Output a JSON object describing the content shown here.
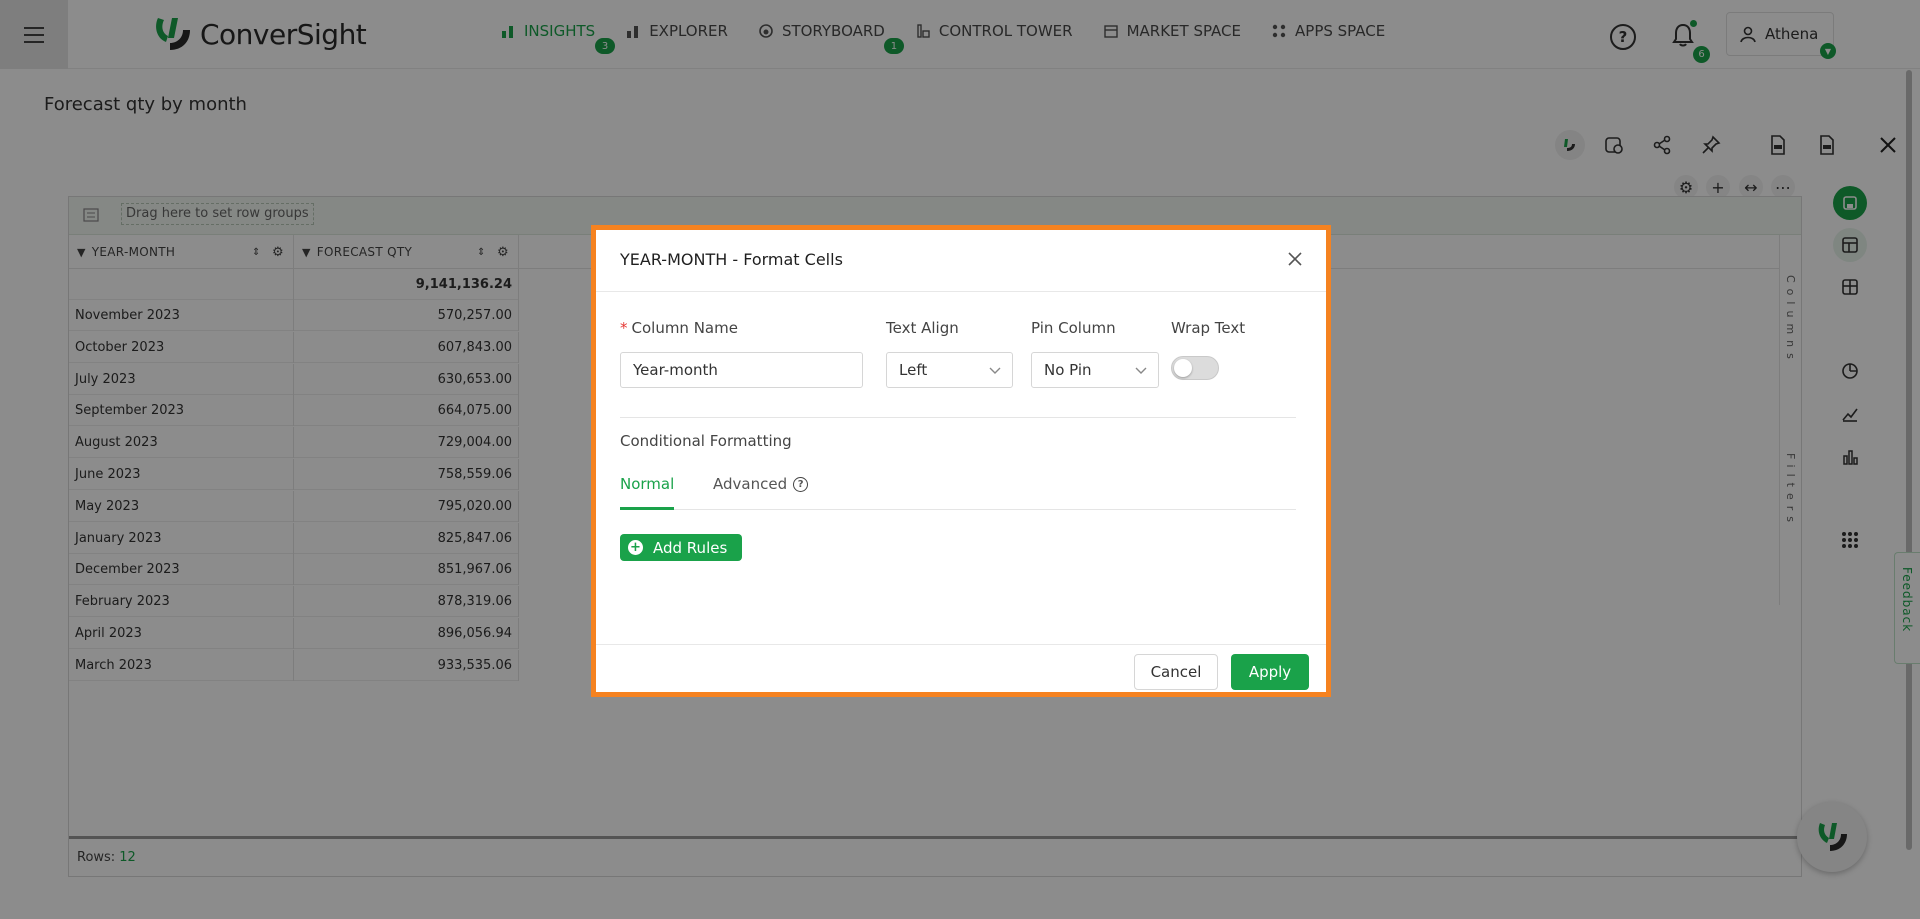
{
  "app": {
    "brand_name": "ConverSight",
    "colors": {
      "accent": "#1aa24a",
      "highlight": "#f58220"
    }
  },
  "nav": {
    "items": [
      {
        "label": "INSIGHTS",
        "icon": "bar-chart-icon",
        "badge": "3",
        "active": true
      },
      {
        "label": "EXPLORER",
        "icon": "explorer-icon",
        "badge": ""
      },
      {
        "label": "STORYBOARD",
        "icon": "storyboard-icon",
        "badge": "1"
      },
      {
        "label": "CONTROL TOWER",
        "icon": "control-tower-icon",
        "badge": ""
      },
      {
        "label": "MARKET SPACE",
        "icon": "market-space-icon",
        "badge": ""
      },
      {
        "label": "APPS SPACE",
        "icon": "apps-space-icon",
        "badge": ""
      }
    ],
    "notifications_count": "6",
    "user_name": "Athena"
  },
  "page": {
    "title": "Forecast qty by month"
  },
  "grid": {
    "drag_hint": "Drag here to set row groups",
    "columns": [
      "YEAR-MONTH",
      "FORECAST QTY"
    ],
    "total": "9,141,136.24",
    "rows": [
      {
        "month": "November 2023",
        "qty": "570,257.00"
      },
      {
        "month": "October 2023",
        "qty": "607,843.00"
      },
      {
        "month": "July 2023",
        "qty": "630,653.00"
      },
      {
        "month": "September 2023",
        "qty": "664,075.00"
      },
      {
        "month": "August 2023",
        "qty": "729,004.00"
      },
      {
        "month": "June 2023",
        "qty": "758,559.06"
      },
      {
        "month": "May 2023",
        "qty": "795,020.00"
      },
      {
        "month": "January 2023",
        "qty": "825,847.06"
      },
      {
        "month": "December 2023",
        "qty": "851,967.06"
      },
      {
        "month": "February 2023",
        "qty": "878,319.06"
      },
      {
        "month": "April 2023",
        "qty": "896,056.94"
      },
      {
        "month": "March 2023",
        "qty": "933,535.06"
      }
    ],
    "side_columns_label": "Columns",
    "side_filters_label": "Filters",
    "footer_rows_label": "Rows:",
    "footer_rows_count": "12"
  },
  "feedback_label": "Feedback",
  "modal": {
    "title": "YEAR-MONTH - Format Cells",
    "column_name_label": "Column Name",
    "column_name_value": "Year-month",
    "text_align_label": "Text Align",
    "text_align_value": "Left",
    "pin_column_label": "Pin Column",
    "pin_column_value": "No Pin",
    "wrap_text_label": "Wrap Text",
    "wrap_text_on": false,
    "conditional_formatting_label": "Conditional Formatting",
    "tabs": [
      {
        "label": "Normal",
        "active": true
      },
      {
        "label": "Advanced",
        "active": false
      }
    ],
    "add_rules_label": "Add Rules",
    "cancel_label": "Cancel",
    "apply_label": "Apply"
  }
}
